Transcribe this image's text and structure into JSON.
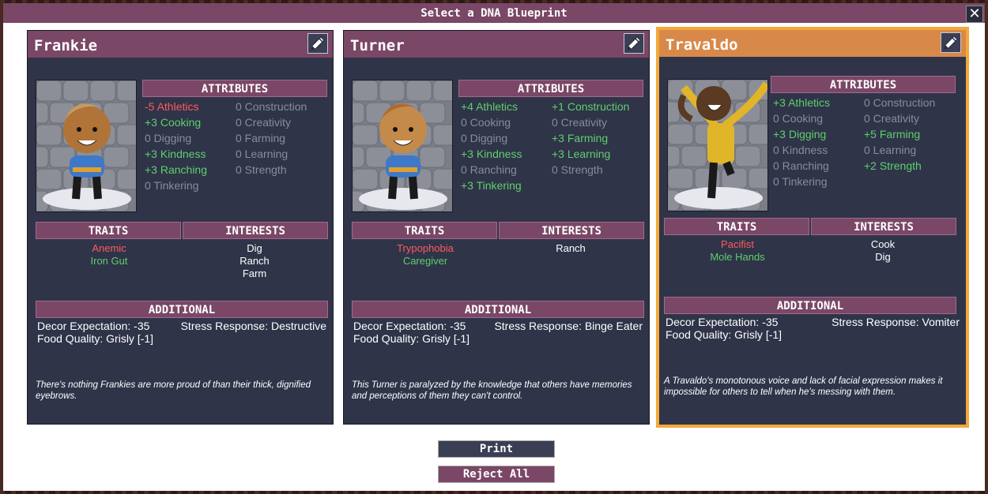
{
  "dialog": {
    "title": "Select a DNA Blueprint",
    "close_label": "✕"
  },
  "section_labels": {
    "attributes": "ATTRIBUTES",
    "traits": "TRAITS",
    "interests": "INTERESTS",
    "additional": "ADDITIONAL"
  },
  "cards": [
    {
      "name": "Frankie",
      "selected": false,
      "attributes_left": [
        "-5 Athletics",
        "+3 Cooking",
        "0 Digging",
        "+3 Kindness",
        "+3 Ranching",
        "0 Tinkering"
      ],
      "attributes_right": [
        "0 Construction",
        "0 Creativity",
        "0 Farming",
        "0 Learning",
        "0 Strength"
      ],
      "traits": [
        "Anemic",
        "Iron Gut"
      ],
      "interests": [
        "Dig",
        "Ranch",
        "Farm"
      ],
      "decor": "Decor Expectation: -35",
      "stress": "Stress Response: Destructive",
      "food": "Food Quality: Grisly [-1]",
      "flavor": "There's nothing Frankies are more proud of than their thick, dignified eyebrows."
    },
    {
      "name": "Turner",
      "selected": false,
      "attributes_left": [
        "+4 Athletics",
        "0 Cooking",
        "0 Digging",
        "+3 Kindness",
        "0 Ranching",
        "+3 Tinkering"
      ],
      "attributes_right": [
        "+1 Construction",
        "0 Creativity",
        "+3 Farming",
        "+3 Learning",
        "0 Strength"
      ],
      "traits": [
        "Trypophobia",
        "Caregiver"
      ],
      "interests": [
        "Ranch"
      ],
      "decor": "Decor Expectation: -35",
      "stress": "Stress Response: Binge Eater",
      "food": "Food Quality: Grisly [-1]",
      "flavor": "This Turner is paralyzed by the knowledge that others have memories and perceptions of them they can't control."
    },
    {
      "name": "Travaldo",
      "selected": true,
      "attributes_left": [
        "+3 Athletics",
        "0 Cooking",
        "+3 Digging",
        "0 Kindness",
        "0 Ranching",
        "0 Tinkering"
      ],
      "attributes_right": [
        "0 Construction",
        "0 Creativity",
        "+5 Farming",
        "0 Learning",
        "+2 Strength"
      ],
      "traits": [
        "Pacifist",
        "Mole Hands"
      ],
      "interests": [
        "Cook",
        "Dig"
      ],
      "decor": "Decor Expectation: -35",
      "stress": "Stress Response: Vomiter",
      "food": "Food Quality: Grisly [-1]",
      "flavor": "A Travaldo's monotonous voice and lack of facial expression makes it impossible for others to tell when he's messing with them."
    }
  ],
  "icons": {
    "edit": "pencil-icon",
    "close": "close-icon"
  },
  "colors": {
    "header": "#7a4766",
    "selected_header": "#d8894a",
    "selected_border": "#f2a93b",
    "card_bg": "#2f3449",
    "positive": "#5fcf6a",
    "negative": "#ff5b5b",
    "neutral": "#8a8c98"
  },
  "buttons": {
    "print": "Print",
    "reject_all": "Reject All"
  }
}
